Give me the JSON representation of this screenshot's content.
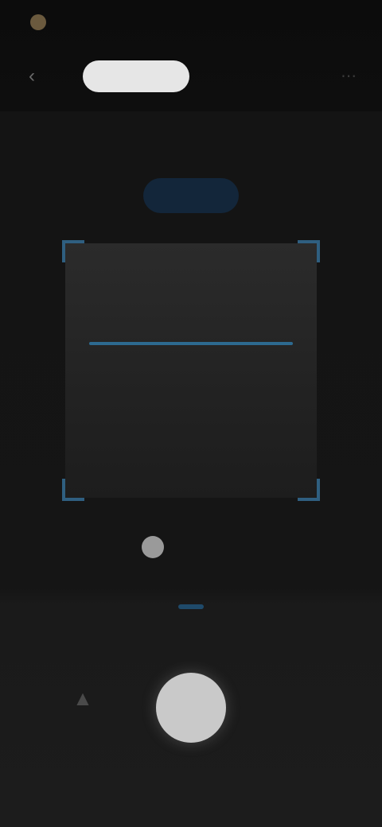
{
  "status_bar": {
    "left_text": "",
    "right_text": ""
  },
  "top_bar": {
    "back_icon": "back-arrow-icon",
    "tabs": [
      {
        "label": "",
        "active": true
      },
      {
        "label": "",
        "active": false
      }
    ],
    "right_icon": "more-icon"
  },
  "scanner": {
    "hint": "",
    "caption": "",
    "accent_color": "#2d6a90"
  },
  "flash": {
    "icon": "flashlight-icon",
    "label": ""
  },
  "modes": {
    "items": [
      {
        "label": ""
      },
      {
        "label": ""
      },
      {
        "label": "",
        "selected": true
      }
    ]
  },
  "controls": {
    "gallery_icon": "gallery-icon",
    "gallery_label": "",
    "shutter_icon": "shutter-icon"
  }
}
